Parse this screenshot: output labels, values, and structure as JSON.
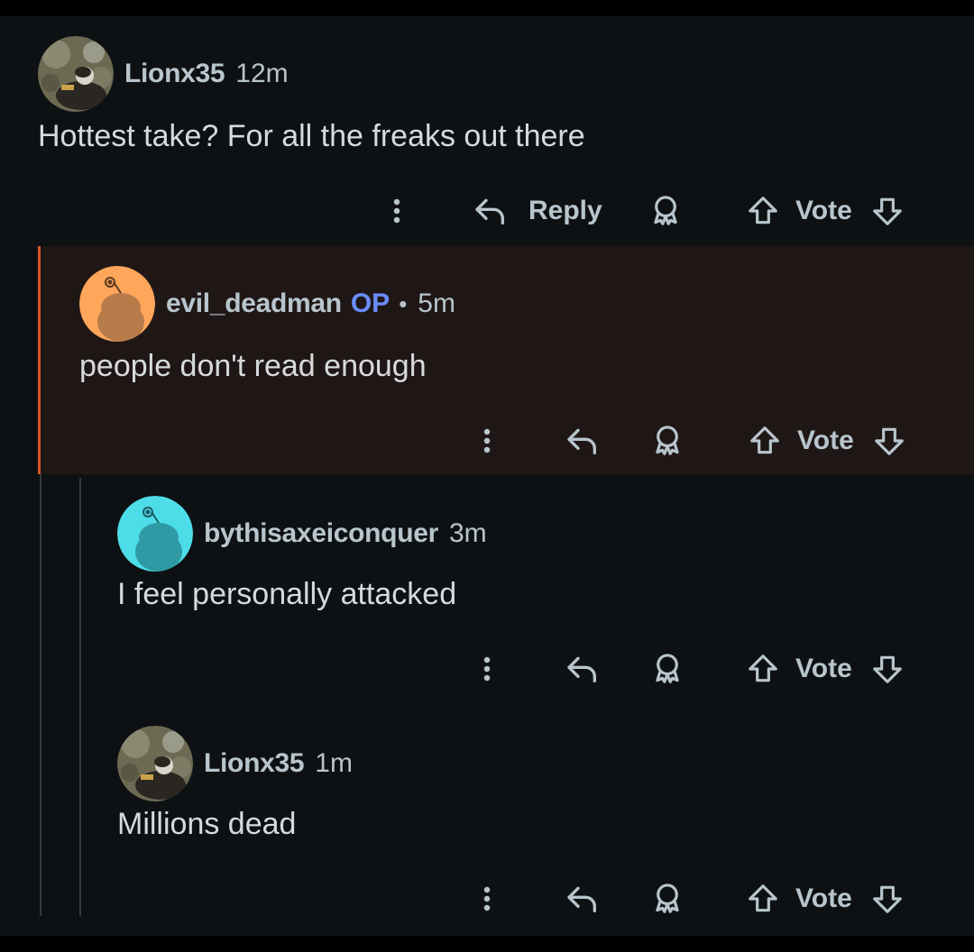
{
  "comments": [
    {
      "username": "Lionx35",
      "op_label": "",
      "separator": "",
      "time": "12m",
      "body": "Hottest take? For all the freaks out there",
      "reply_label": "Reply",
      "vote_label": "Vote",
      "avatar": "photo-avatar"
    },
    {
      "username": "evil_deadman",
      "op_label": "OP",
      "separator": "•",
      "time": "5m",
      "body": "people don't read enough",
      "reply_label": "",
      "vote_label": "Vote",
      "avatar": "snoo-avatar-orange"
    },
    {
      "username": "bythisaxeiconquer",
      "op_label": "",
      "separator": "",
      "time": "3m",
      "body": "I feel personally attacked",
      "reply_label": "",
      "vote_label": "Vote",
      "avatar": "snoo-avatar-cyan"
    },
    {
      "username": "Lionx35",
      "op_label": "",
      "separator": "",
      "time": "1m",
      "body": "Millions dead",
      "reply_label": "",
      "vote_label": "Vote",
      "avatar": "photo-avatar"
    }
  ],
  "icons": {
    "more": "vertical-ellipsis-icon",
    "reply": "reply-arrow-icon",
    "award": "award-icon",
    "upvote": "upvote-arrow-icon",
    "downvote": "downvote-arrow-icon"
  },
  "colors": {
    "background": "#0e1113",
    "highlight_background": "#1f1716",
    "highlight_border": "#d7542a",
    "op_label": "#6a8dff",
    "avatar_orange": "#ffa65b",
    "avatar_cyan": "#4ddde9"
  }
}
